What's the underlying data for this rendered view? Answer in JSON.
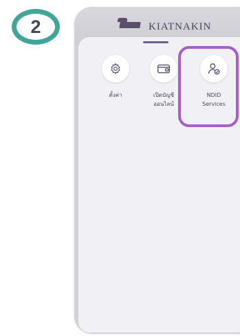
{
  "step": {
    "number": "2"
  },
  "header": {
    "bank_name": "KIATNAKIN"
  },
  "menu": {
    "items": [
      {
        "icon": "gear-icon",
        "label": "ตั้งค่า"
      },
      {
        "icon": "wallet-icon",
        "label": "เปิดบัญชี\nออนไลน์"
      },
      {
        "icon": "user-check-icon",
        "label": "NDID\nServices"
      }
    ]
  },
  "colors": {
    "badge_ring": "#43a597",
    "highlight": "#a65fc8",
    "icon_stroke": "#5a4f6a",
    "sheet_bg": "#f1f0f5"
  }
}
